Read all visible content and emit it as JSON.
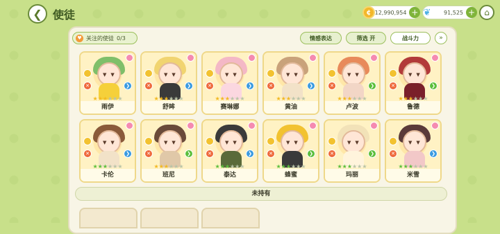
{
  "header": {
    "title": "使徒",
    "gold": "12,990,954",
    "gems": "91,525"
  },
  "toolbar": {
    "follow_label": "关注的使徒",
    "follow_count": "0/3",
    "emote_label": "情感表达",
    "filter_label": "筛选 开",
    "power_label": "战斗力"
  },
  "characters": [
    {
      "name": "雨伊",
      "hair": "#7fbf6a",
      "outfit": "#f5d03a",
      "elem": "#3b9be0",
      "elem_icon": "❯",
      "stars": "gold"
    },
    {
      "name": "舒眸",
      "hair": "#f1d470",
      "outfit": "#3a3a3a",
      "elem": "#3b9be0",
      "elem_icon": "❯",
      "stars": "gold"
    },
    {
      "name": "赛琳娜",
      "hair": "#f4b8c6",
      "outfit": "#fbd7e0",
      "elem": "#3b9be0",
      "elem_icon": "❯",
      "stars": "gold"
    },
    {
      "name": "黄油",
      "hair": "#c9a27a",
      "outfit": "#f2e2c8",
      "elem": "#3b9be0",
      "elem_icon": "❯",
      "stars": "gold"
    },
    {
      "name": "卢波",
      "hair": "#e88a5a",
      "outfit": "#f2d6c6",
      "elem": "#5cbf3c",
      "elem_icon": "❯",
      "stars": "gold"
    },
    {
      "name": "鲁德",
      "hair": "#b23a3a",
      "outfit": "#7a1f2a",
      "elem": "#5cbf3c",
      "elem_icon": "❯",
      "stars": "gold"
    },
    {
      "name": "卡伦",
      "hair": "#8a5a3a",
      "outfit": "#f2e2c8",
      "elem": "#3b9be0",
      "elem_icon": "❯",
      "stars": "green"
    },
    {
      "name": "班尼",
      "hair": "#6a4a3a",
      "outfit": "#e0c8a8",
      "elem": "#5cbf3c",
      "elem_icon": "❯",
      "stars": "gold"
    },
    {
      "name": "泰达",
      "hair": "#3a3a3a",
      "outfit": "#5a6a3a",
      "elem": "#3b9be0",
      "elem_icon": "❯",
      "stars": "green"
    },
    {
      "name": "蜂蜜",
      "hair": "#f2c230",
      "outfit": "#3a3a3a",
      "elem": "#5cbf3c",
      "elem_icon": "❯",
      "stars": "green"
    },
    {
      "name": "玛丽",
      "hair": "#f2e2b8",
      "outfit": "#fff4dc",
      "elem": "#5cbf3c",
      "elem_icon": "❯",
      "stars": "green"
    },
    {
      "name": "米雪",
      "hair": "#5a3a3a",
      "outfit": "#f2c8c8",
      "elem": "#3b9be0",
      "elem_icon": "❯",
      "stars": "green"
    }
  ],
  "unowned_label": "未持有"
}
